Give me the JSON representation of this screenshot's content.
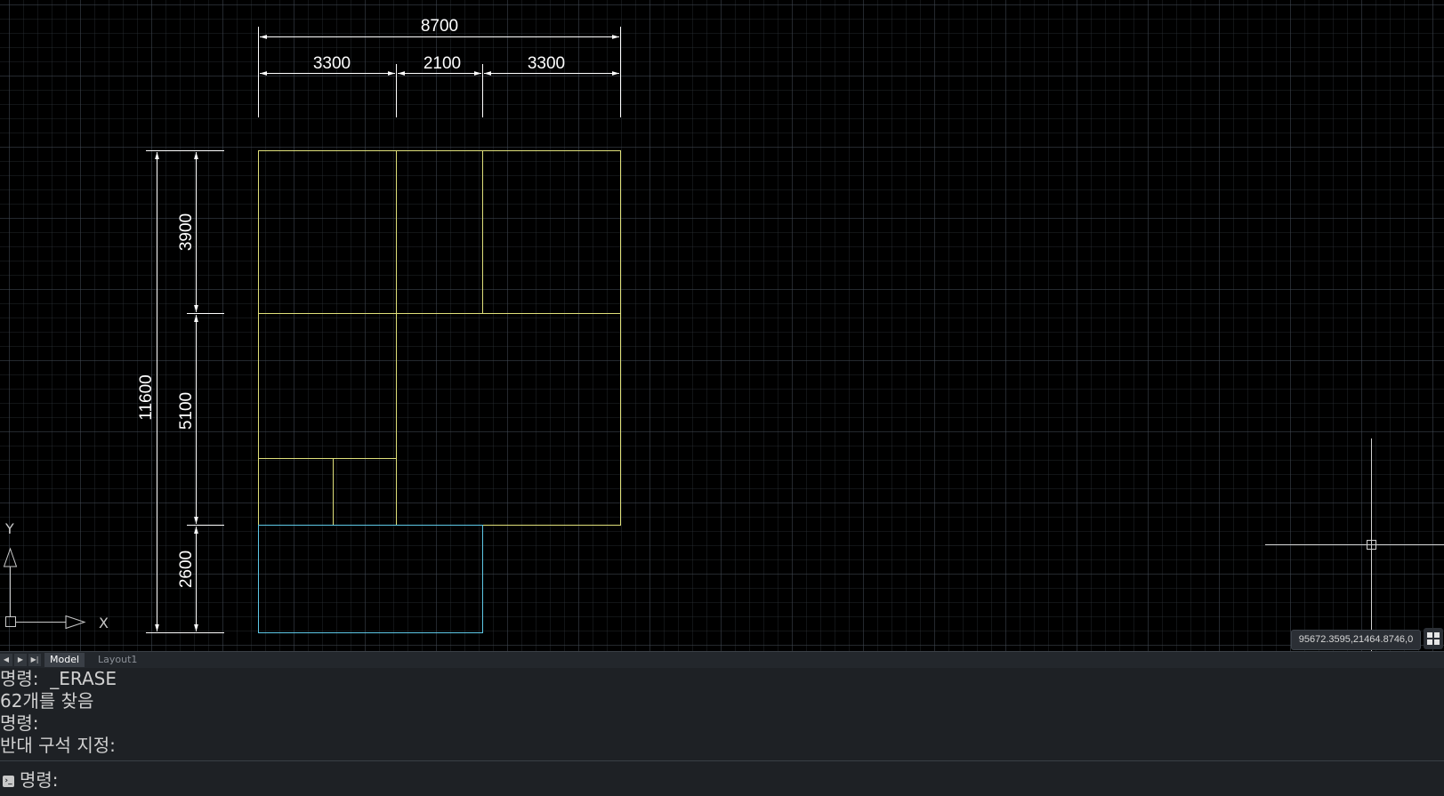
{
  "drawing": {
    "dimensions": {
      "overall_width": "8700",
      "width_left": "3300",
      "width_middle": "2100",
      "width_right": "3300",
      "overall_height": "11600",
      "height_top": "3900",
      "height_middle": "5100",
      "height_bottom": "2600"
    },
    "colors": {
      "plan_lines": "#e0e07a",
      "lower_room": "#5ec8e6",
      "dimension_lines": "#ffffff"
    },
    "ucs": {
      "x_label": "X",
      "y_label": "Y"
    }
  },
  "status": {
    "coordinates": "95672.3595,21464.8746,0"
  },
  "tabs": {
    "model": "Model",
    "layout1": "Layout1"
  },
  "command_history": [
    "명령:  _ERASE",
    "62개를 찾음",
    "명령:",
    "반대 구석 지정:"
  ],
  "command_prompt": "명령:"
}
